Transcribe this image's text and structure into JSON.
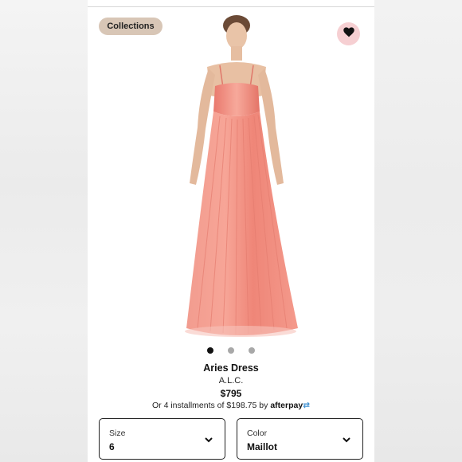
{
  "header": {
    "collections_label": "Collections"
  },
  "icons": {
    "favorite": "heart-icon",
    "dropdown": "chevron-down-icon"
  },
  "carousel": {
    "count": 3,
    "active_index": 0
  },
  "product": {
    "name": "Aries Dress",
    "brand": "A.L.C.",
    "price": "$795",
    "installments_text": "Or 4 installments of $198.75 by",
    "afterpay_brand": "afterpay"
  },
  "selectors": {
    "size": {
      "label": "Size",
      "value": "6"
    },
    "color": {
      "label": "Color",
      "value": "Maillot"
    }
  },
  "colors": {
    "dress": "#f2887c",
    "heart_bg": "#f6cfd2",
    "collections_bg": "#d8c6b6",
    "afterpay_mark": "#3d8fd0"
  }
}
